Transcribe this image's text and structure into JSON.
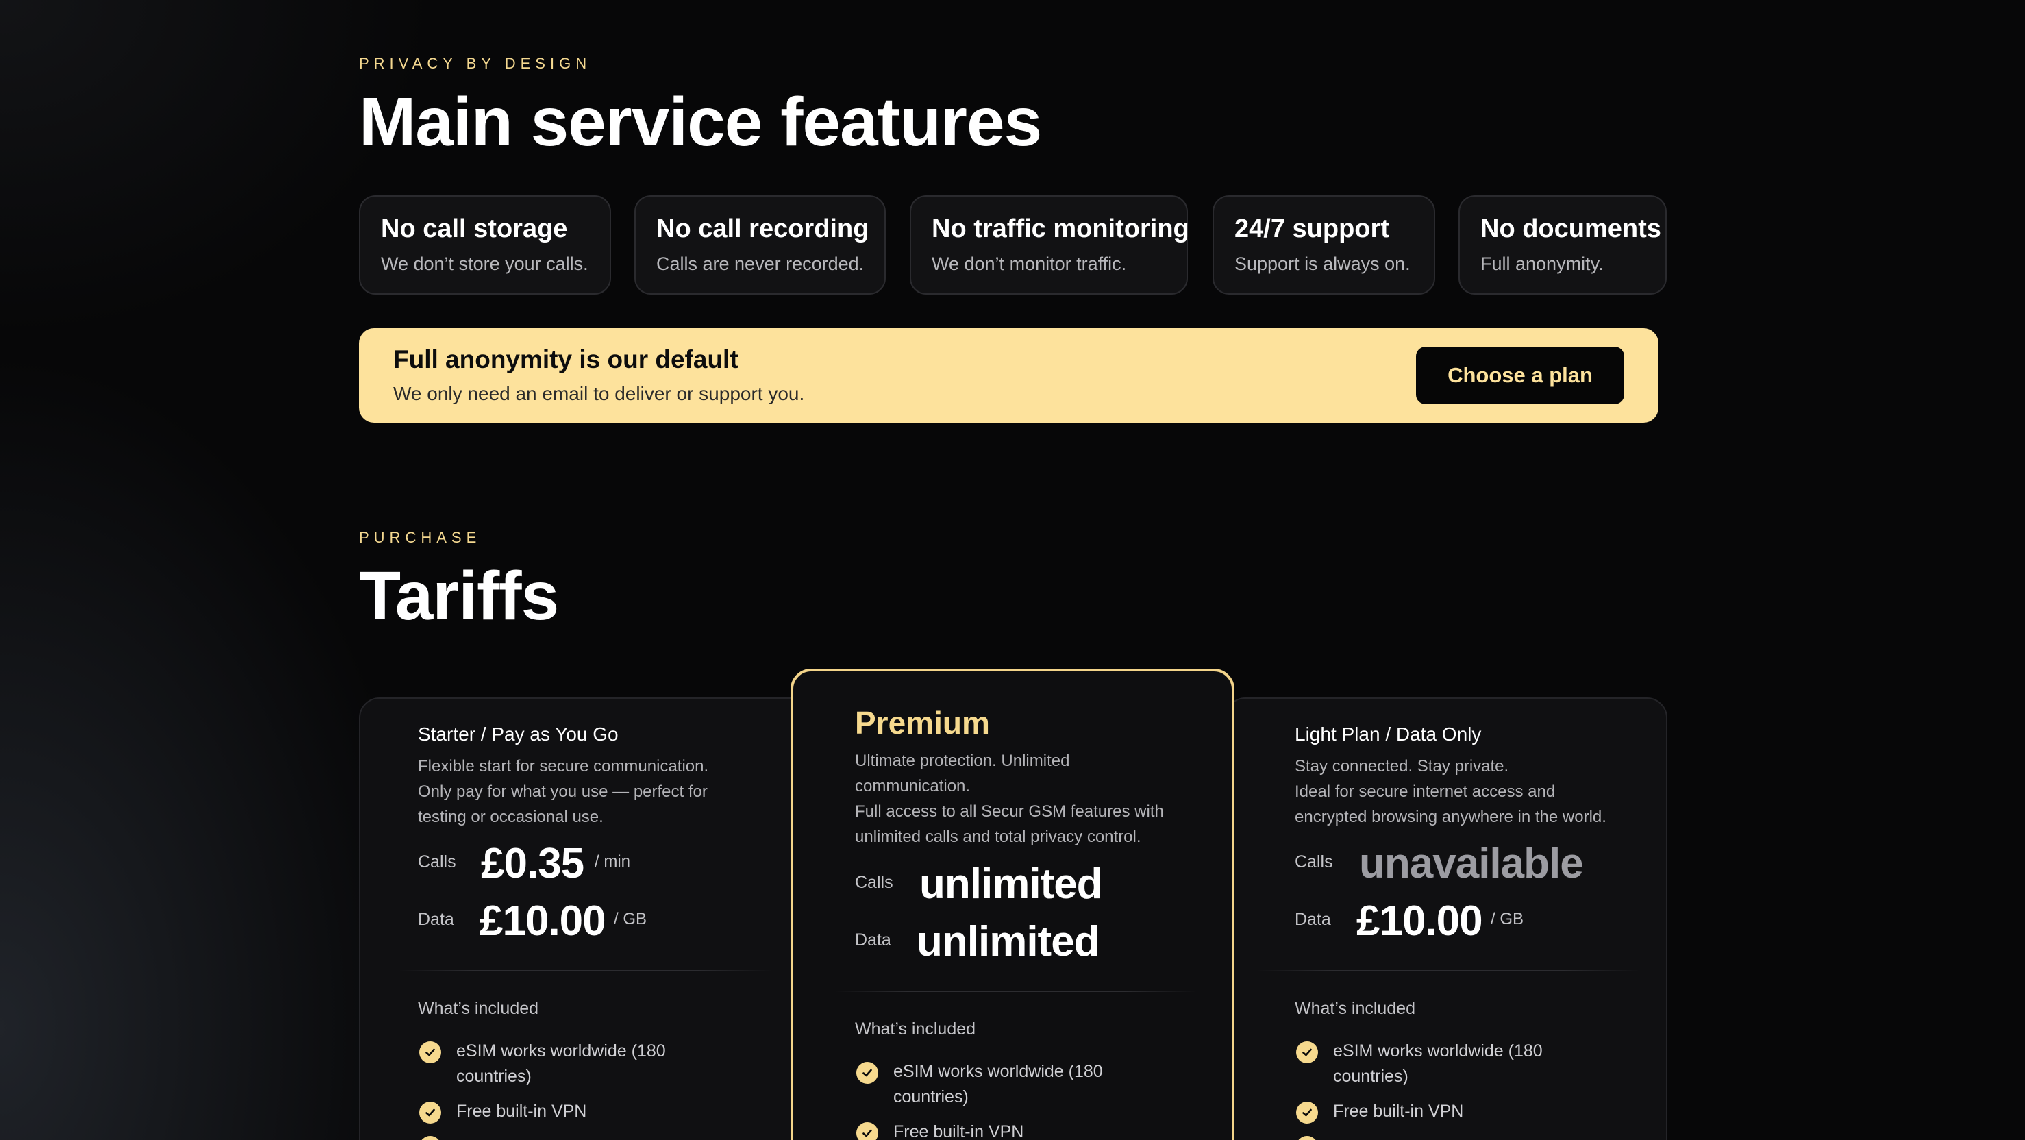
{
  "features_section": {
    "eyebrow": "PRIVACY BY DESIGN",
    "title": "Main service features",
    "cards": [
      {
        "title": "No call storage",
        "desc": "We don’t store your calls."
      },
      {
        "title": "No call recording",
        "desc": "Calls are never recorded."
      },
      {
        "title": "No traffic monitoring",
        "desc": "We don’t monitor traffic."
      },
      {
        "title": "24/7 support",
        "desc": "Support is always on."
      },
      {
        "title": "No documents",
        "desc": "Full anonymity."
      }
    ]
  },
  "banner": {
    "title": "Full anonymity is our default",
    "subtitle": "We only need an email to deliver or support you.",
    "button": "Choose a plan"
  },
  "tariffs_section": {
    "eyebrow": "PURCHASE",
    "title": "Tariffs"
  },
  "plans": [
    {
      "name": "Starter / Pay as You Go",
      "desc_lines": [
        "Flexible start for secure communication.",
        "Only pay for what you use — perfect for",
        "testing or occasional use."
      ],
      "calls_label": "Calls",
      "calls_value": "£0.35",
      "calls_unit": "/ min",
      "data_label": "Data",
      "data_value": "£10.00",
      "data_unit": "/ GB",
      "included_label": "What’s included",
      "features": [
        [
          "eSIM works worldwide (180",
          "countries)"
        ],
        [
          "Free built-in VPN"
        ]
      ]
    },
    {
      "name": "Premium",
      "desc_lines": [
        "Ultimate protection. Unlimited",
        "communication.",
        "Full access to all Secur GSM features with",
        "unlimited calls and total privacy control."
      ],
      "calls_label": "Calls",
      "calls_value": "unlimited",
      "data_label": "Data",
      "data_value": "unlimited",
      "included_label": "What’s included",
      "features": [
        [
          "eSIM works worldwide (180",
          "countries)"
        ],
        [
          "Free built-in VPN"
        ]
      ]
    },
    {
      "name": "Light Plan / Data Only",
      "desc_lines": [
        "Stay connected. Stay private.",
        "Ideal for secure internet access and",
        "encrypted browsing anywhere in the world."
      ],
      "calls_label": "Calls",
      "calls_value": "unavailable",
      "data_label": "Data",
      "data_value": "£10.00",
      "data_unit": "/ GB",
      "included_label": "What’s included",
      "features": [
        [
          "eSIM works worldwide (180",
          "countries)"
        ],
        [
          "Free built-in VPN"
        ]
      ]
    }
  ],
  "colors": {
    "accent": "#f6d98e",
    "banner": "#fde29c",
    "background": "#070708"
  }
}
